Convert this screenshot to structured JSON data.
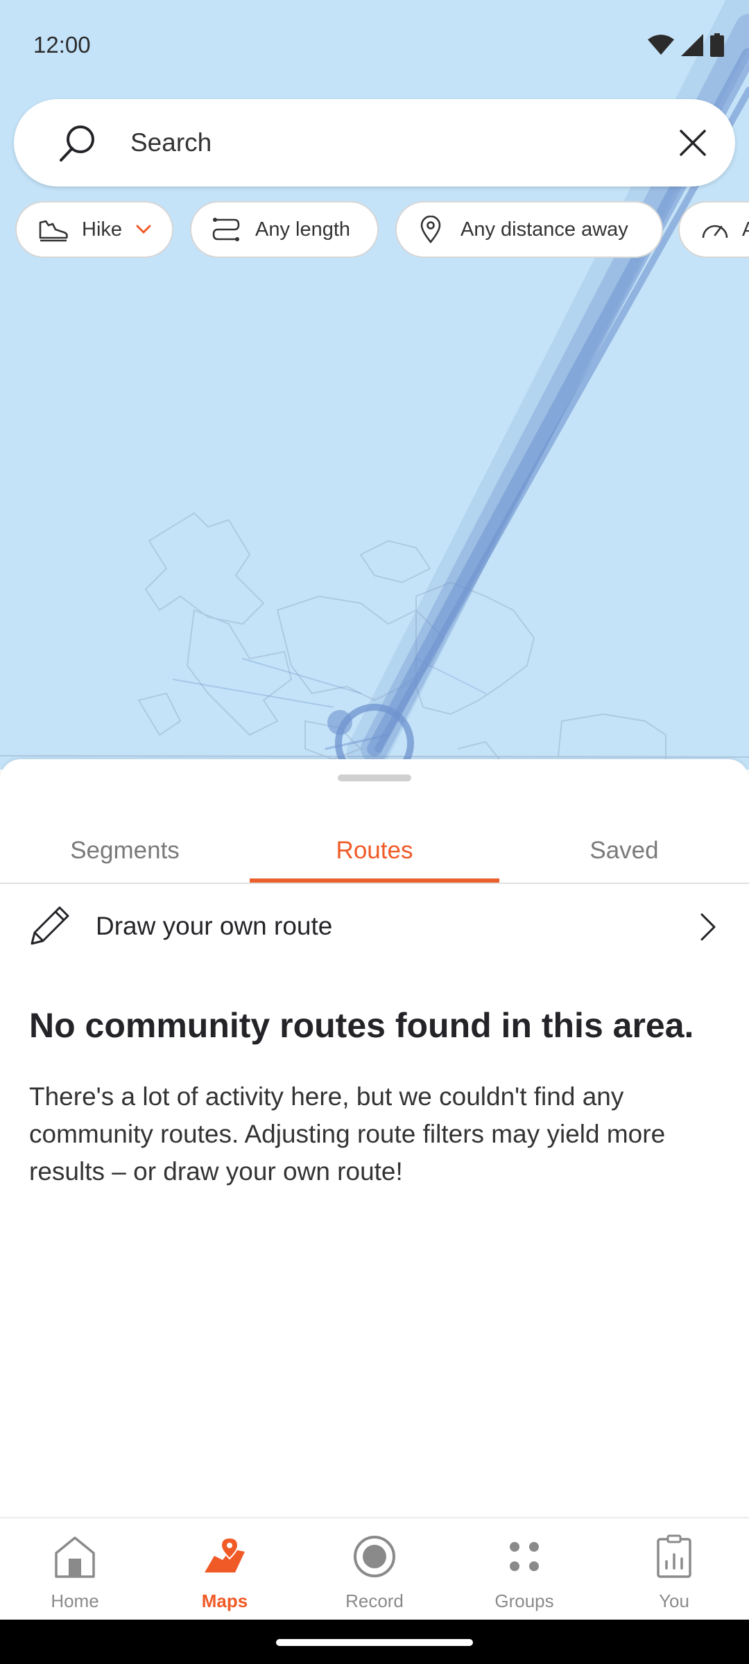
{
  "status": {
    "time": "12:00"
  },
  "search": {
    "placeholder": "Search"
  },
  "filters": [
    {
      "label": "Hike"
    },
    {
      "label": "Any length"
    },
    {
      "label": "Any distance away"
    },
    {
      "label": "A"
    }
  ],
  "tabs": [
    {
      "label": "Segments"
    },
    {
      "label": "Routes"
    },
    {
      "label": "Saved"
    }
  ],
  "active_tab": "Routes",
  "draw_route": {
    "label": "Draw your own route"
  },
  "empty_state": {
    "title": "No community routes found in this area.",
    "body": "There's a lot of activity here, but we couldn't find any community routes. Adjusting route filters may yield more results – or draw your own route!"
  },
  "nav": [
    {
      "label": "Home",
      "icon": "home-icon"
    },
    {
      "label": "Maps",
      "icon": "maps-icon"
    },
    {
      "label": "Record",
      "icon": "record-icon"
    },
    {
      "label": "Groups",
      "icon": "groups-icon"
    },
    {
      "label": "You",
      "icon": "you-icon"
    }
  ],
  "colors": {
    "accent": "#f05a26",
    "map_water": "#c4e3f8",
    "heatmap": "#6f93cf"
  }
}
